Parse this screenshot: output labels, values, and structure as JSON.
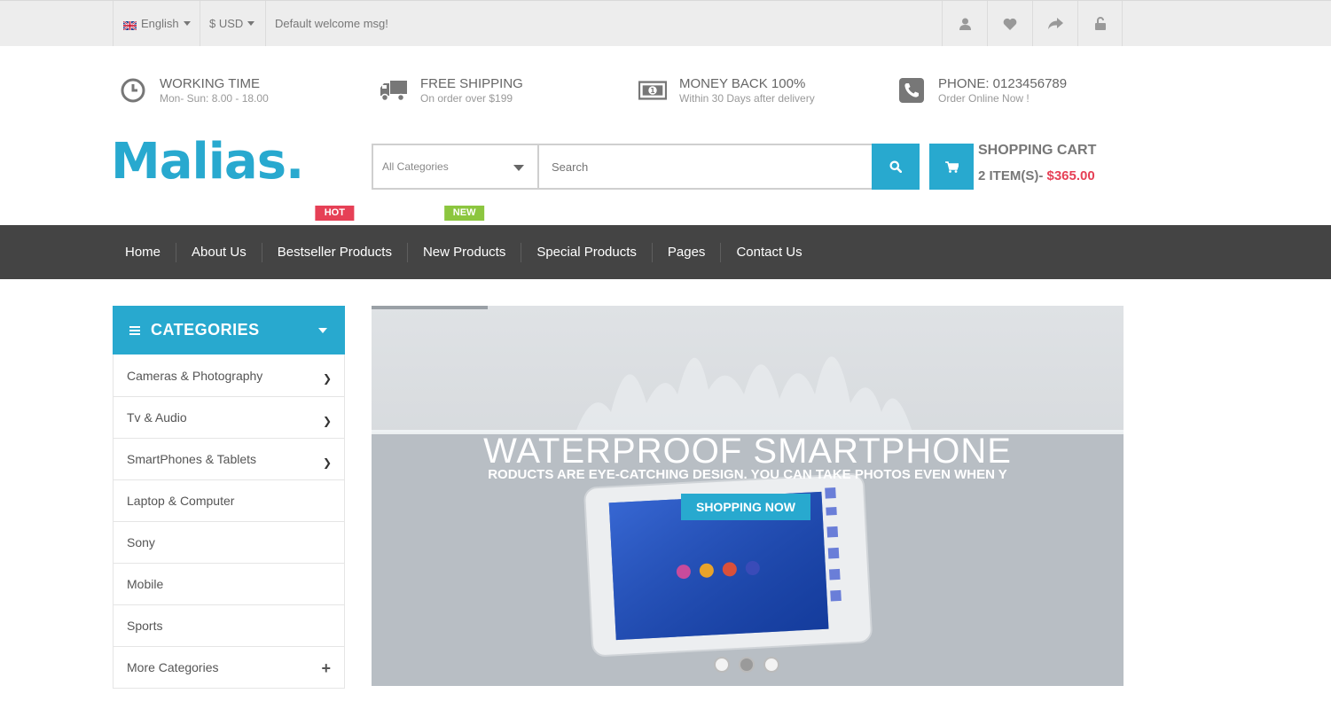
{
  "topbar": {
    "language": "English",
    "currency": "$ USD",
    "welcome": "Default welcome msg!",
    "icons": [
      "user-icon",
      "heart-icon",
      "share-icon",
      "unlock-icon"
    ]
  },
  "info": [
    {
      "title": "WORKING TIME",
      "subtitle": "Mon- Sun: 8.00 - 18.00",
      "icon": "clock-icon"
    },
    {
      "title": "FREE SHIPPING",
      "subtitle": "On order over $199",
      "icon": "truck-icon"
    },
    {
      "title": "MONEY BACK 100%",
      "subtitle": "Within 30 Days after delivery",
      "icon": "money-icon"
    },
    {
      "title": "PHONE: 0123456789",
      "subtitle": "Order Online Now !",
      "icon": "phone-icon"
    }
  ],
  "logo": "Malias.",
  "search": {
    "category": "All Categories",
    "placeholder": "Search"
  },
  "cart": {
    "title": "SHOPPING CART",
    "items": "2 ITEM(S)- ",
    "total": "$365.00"
  },
  "nav": [
    {
      "label": "Home"
    },
    {
      "label": "About Us"
    },
    {
      "label": "Bestseller Products",
      "badge": "HOT"
    },
    {
      "label": "New Products",
      "badge": "NEW"
    },
    {
      "label": "Special Products"
    },
    {
      "label": "Pages"
    },
    {
      "label": "Contact Us"
    }
  ],
  "categories": {
    "title": "CATEGORIES",
    "items": [
      "Cameras & Photography",
      "Tv & Audio",
      "SmartPhones & Tablets",
      "Laptop & Computer",
      "Sony",
      "Mobile",
      "Sports",
      "More Categories"
    ]
  },
  "slider": {
    "title": "WATERPROOF SMARTPHONE",
    "subtitle": "RODUCTS ARE EYE-CATCHING DESIGN. YOU CAN TAKE PHOTOS EVEN WHEN Y",
    "button": "SHOPPING NOW",
    "slides": 3,
    "active_slide": 2
  },
  "colors": {
    "accent": "#28a9cf",
    "nav_bg": "#444444",
    "hot": "#e64056",
    "new": "#8cc63f",
    "price": "#e64056"
  }
}
